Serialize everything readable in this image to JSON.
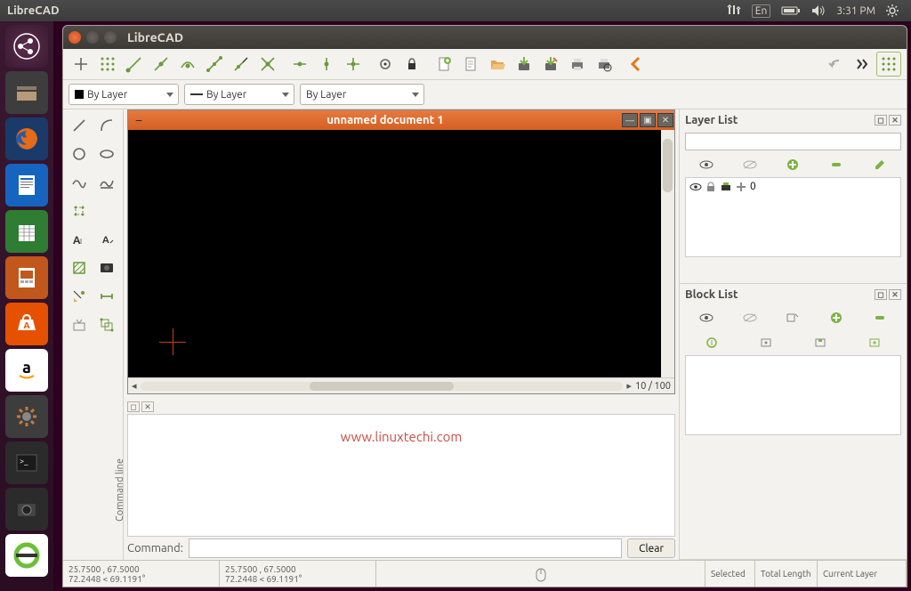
{
  "menubar": {
    "title": "LibreCAD",
    "lang": "En",
    "time": "3:31 PM"
  },
  "window": {
    "title": "LibreCAD"
  },
  "props": {
    "color": "By Layer",
    "width": "By Layer",
    "linetype": "By Layer"
  },
  "document": {
    "title": "unnamed document 1",
    "zoom": "10 / 100"
  },
  "watermark": "www.linuxtechi.com",
  "cmd": {
    "label": "Command:",
    "panel_label": "Command line",
    "clear": "Clear"
  },
  "panels": {
    "layer": {
      "title": "Layer List",
      "default_layer": "0"
    },
    "block": {
      "title": "Block List"
    }
  },
  "status": {
    "abs": "25.7500 , 67.5000",
    "rel": "72.2448 < 69.1191°",
    "abs2": "25.7500 , 67.5000",
    "rel2": "72.2448 < 69.1191°",
    "selected": "Selected",
    "total_len": "Total Length",
    "current_layer": "Current Layer"
  }
}
